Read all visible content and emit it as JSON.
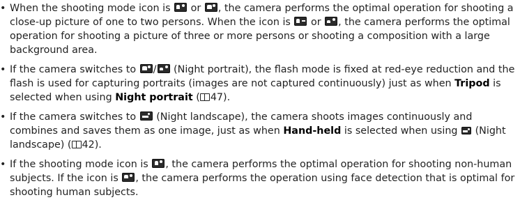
{
  "bullet": "•",
  "items": [
    {
      "t1": "When the shooting mode icon is ",
      "t2": " or ",
      "t3": ", the camera performs the optimal operation for shooting a close-up picture of one to two persons. When the icon is ",
      "t4": " or ",
      "t5": ", the camera performs the optimal operation for shooting a picture of three or more persons or shooting a composition with a large background area."
    },
    {
      "t1": "If the camera switches to ",
      "t2": "/",
      "t3": " (Night portrait), the flash mode is fixed at red-eye reduction and the flash is used for capturing portraits (images are not captured continuously) just as when ",
      "b1": "Tripod",
      "t4": " is selected when using ",
      "b2": "Night portrait",
      "t5": " (",
      "ref": "47",
      "t6": ")."
    },
    {
      "t1": "If the camera switches to ",
      "t2": " (Night landscape), the camera shoots images continuously and combines and saves them as one image, just as when ",
      "b1": "Hand-held",
      "t3": " is selected when using ",
      "t4": " (Night landscape) (",
      "ref": "42",
      "t5": ")."
    },
    {
      "t1": "If the shooting mode icon is ",
      "t2": ", the camera performs the optimal operation for shooting non-human subjects. If the icon is ",
      "t3": ", the camera performs the operation using face detection that is optimal for shooting human subjects."
    }
  ],
  "icons": {
    "closeup_a": "portrait-closeup-icon",
    "closeup_b": "portrait-closeup-backlit-icon",
    "group_a": "portrait-group-icon",
    "group_b": "portrait-group-backlit-icon",
    "night_portrait": "night-portrait-icon",
    "night_landscape": "night-landscape-icon",
    "nonhuman": "nonhuman-subject-icon",
    "human": "human-subject-icon",
    "book": "page-reference-icon"
  }
}
